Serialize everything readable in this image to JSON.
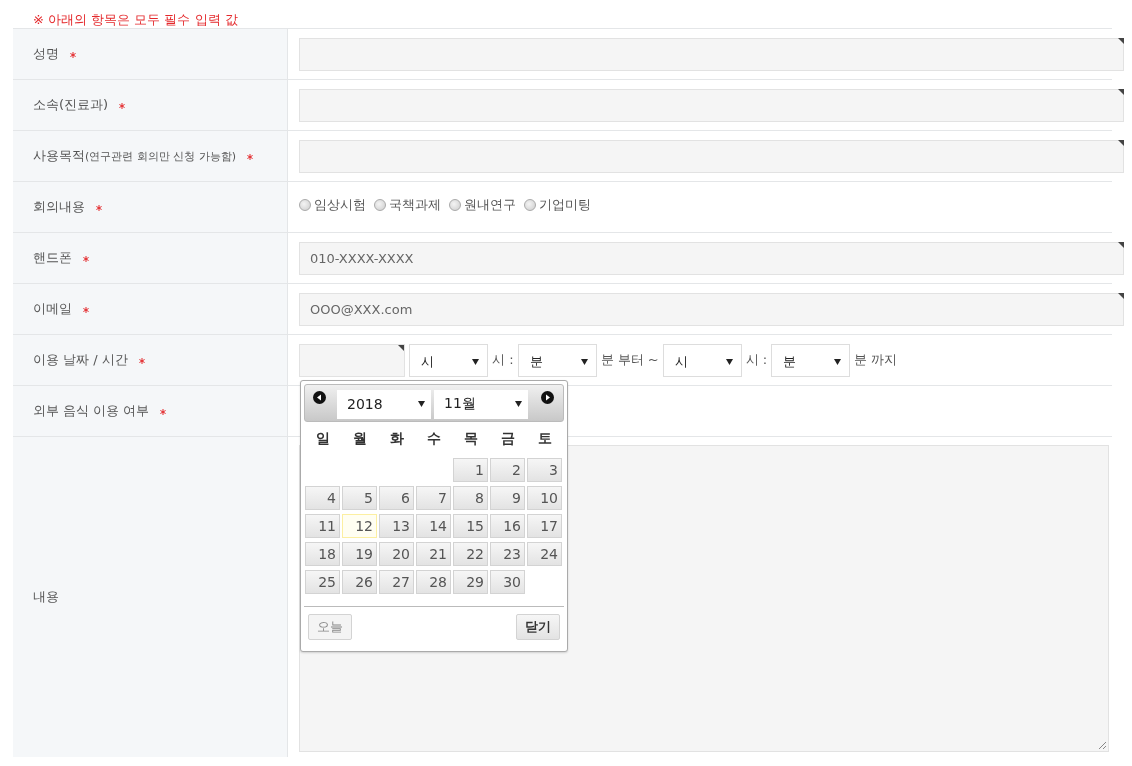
{
  "notice": "※ 아래의 항목은 모두 필수 입력 값",
  "rows": [
    {
      "kind": "text",
      "label": "성명",
      "required": true
    },
    {
      "kind": "text",
      "label": "소속(진료과)",
      "required": true
    },
    {
      "kind": "text",
      "label": "사용목적",
      "note": "(연구관련 회의만 신청 가능함)",
      "required": true
    },
    {
      "kind": "radio",
      "label": "회의내용",
      "required": true,
      "options": [
        {
          "label": "임상시험",
          "selected": false
        },
        {
          "label": "국책과제",
          "selected": false
        },
        {
          "label": "원내연구",
          "selected": false
        },
        {
          "label": "기업미팅",
          "selected": false
        }
      ]
    },
    {
      "kind": "text",
      "label": "핸드폰",
      "required": true,
      "placeholder": "010-XXXX-XXXX"
    },
    {
      "kind": "text",
      "label": "이메일",
      "required": true,
      "placeholder": "OOO@XXX.com"
    },
    {
      "kind": "datetime",
      "label": "이용 날짜 / 시간",
      "required": true,
      "parts": [
        {
          "kind": "select",
          "value": "시"
        },
        {
          "kind": "text",
          "text": "시 :"
        },
        {
          "kind": "select",
          "value": "분"
        },
        {
          "kind": "text",
          "text": "분 부터 ~"
        },
        {
          "kind": "select",
          "value": "시"
        },
        {
          "kind": "text",
          "text": "시 :"
        },
        {
          "kind": "select",
          "value": "분"
        },
        {
          "kind": "text",
          "text": "분 까지"
        }
      ],
      "calendar": {
        "year": "2018",
        "month": "11월",
        "weekdays": [
          "일",
          "월",
          "화",
          "수",
          "목",
          "금",
          "토"
        ],
        "weeks": [
          [
            {
              "kind": "blank"
            },
            {
              "kind": "blank"
            },
            {
              "kind": "blank"
            },
            {
              "kind": "blank"
            },
            {
              "label": "1",
              "today": false
            },
            {
              "label": "2",
              "today": false
            },
            {
              "label": "3",
              "today": false
            }
          ],
          [
            {
              "label": "4",
              "today": false
            },
            {
              "label": "5",
              "today": false
            },
            {
              "label": "6",
              "today": false
            },
            {
              "label": "7",
              "today": false
            },
            {
              "label": "8",
              "today": false
            },
            {
              "label": "9",
              "today": false
            },
            {
              "label": "10",
              "today": false
            }
          ],
          [
            {
              "label": "11",
              "today": false
            },
            {
              "label": "12",
              "today": true
            },
            {
              "label": "13",
              "today": false
            },
            {
              "label": "14",
              "today": false
            },
            {
              "label": "15",
              "today": false
            },
            {
              "label": "16",
              "today": false
            },
            {
              "label": "17",
              "today": false
            }
          ],
          [
            {
              "label": "18",
              "today": false
            },
            {
              "label": "19",
              "today": false
            },
            {
              "label": "20",
              "today": false
            },
            {
              "label": "21",
              "today": false
            },
            {
              "label": "22",
              "today": false
            },
            {
              "label": "23",
              "today": false
            },
            {
              "label": "24",
              "today": false
            }
          ],
          [
            {
              "label": "25",
              "today": false
            },
            {
              "label": "26",
              "today": false
            },
            {
              "label": "27",
              "today": false
            },
            {
              "label": "28",
              "today": false
            },
            {
              "label": "29",
              "today": false
            },
            {
              "label": "30",
              "today": false
            },
            {
              "kind": "blank"
            }
          ]
        ],
        "today_button": {
          "label": "오늘",
          "disabled": true
        },
        "close_button": {
          "label": "닫기",
          "disabled": false
        }
      }
    },
    {
      "kind": "blank",
      "label": "외부 음식 이용 여부",
      "required": true
    },
    {
      "kind": "textarea",
      "label": "내용",
      "required": false
    }
  ]
}
